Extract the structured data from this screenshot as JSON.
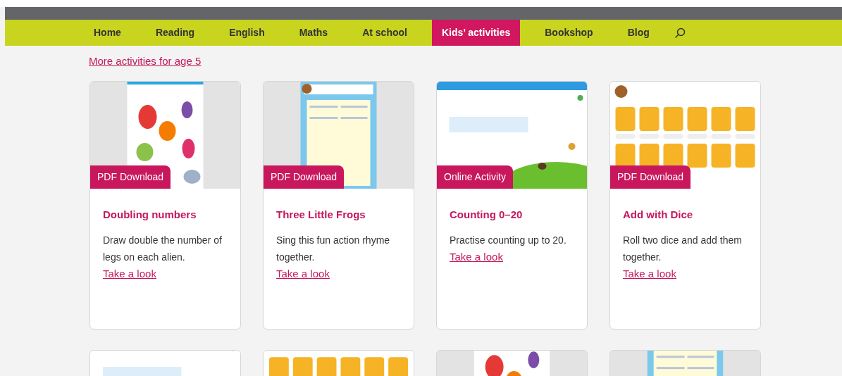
{
  "nav": {
    "items": [
      {
        "label": "Home",
        "selected": false
      },
      {
        "label": "Reading",
        "selected": false
      },
      {
        "label": "English",
        "selected": false
      },
      {
        "label": "Maths",
        "selected": false
      },
      {
        "label": "At school",
        "selected": false
      },
      {
        "label": "Kids’ activities",
        "selected": true
      },
      {
        "label": "Bookshop",
        "selected": false
      },
      {
        "label": "Blog",
        "selected": false
      }
    ]
  },
  "more_link": "More activities for age 5",
  "cards": [
    {
      "kind": "picture",
      "badge": "PDF Download",
      "title": "Doubling numbers",
      "description": "Draw double the number of legs on each alien.",
      "link": "Take a look"
    },
    {
      "kind": "picture",
      "badge": "PDF Download",
      "title": "Three Little Frogs",
      "description": "Sing this fun action rhyme together.",
      "link": "Take a look"
    },
    {
      "kind": "picture",
      "badge": "Online Activity",
      "title": "Counting 0–20",
      "description": "Practise counting up to 20.",
      "link": "Take a look"
    },
    {
      "kind": "picture",
      "badge": "PDF Download",
      "title": "Add with Dice",
      "description": "Roll two dice and add them together.",
      "link": "Take a look"
    }
  ]
}
